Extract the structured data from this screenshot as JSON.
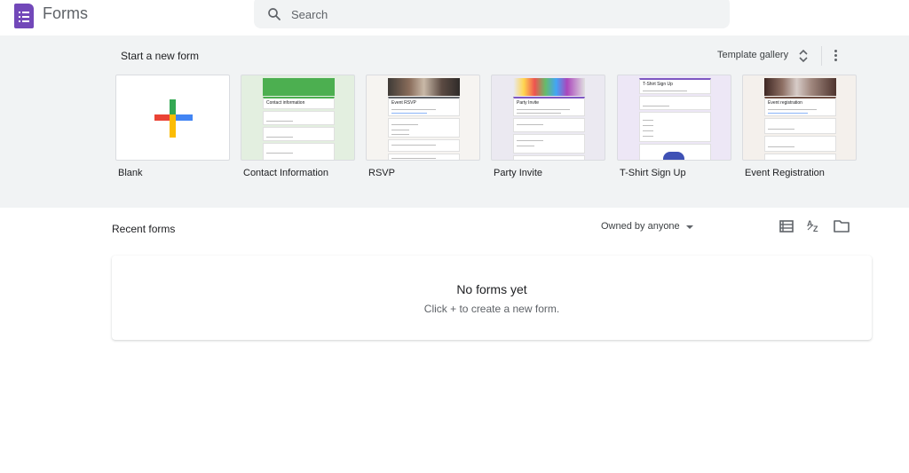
{
  "app": {
    "name": "Forms",
    "logo_icon": "google-forms-icon",
    "brand_color": "#7248b9"
  },
  "search": {
    "placeholder": "Search",
    "icon": "search-icon"
  },
  "start": {
    "title": "Start a new form",
    "gallery_label": "Template gallery",
    "gallery_icon": "unfold-more-icon",
    "more_icon": "more-vert-icon",
    "templates": [
      {
        "label": "Blank",
        "icon": "plus-icon"
      },
      {
        "label": "Contact Information",
        "mini_title": "Contact information",
        "accent": "#4caf50"
      },
      {
        "label": "RSVP",
        "mini_title": "Event RSVP",
        "accent": "#5f6368"
      },
      {
        "label": "Party Invite",
        "mini_title": "Party Invite",
        "accent": "#7e57c2"
      },
      {
        "label": "T-Shirt Sign Up",
        "mini_title": "T-Shirt Sign Up",
        "accent": "#7e57c2"
      },
      {
        "label": "Event Registration",
        "mini_title": "Event registration",
        "accent": "#6d4c41"
      }
    ]
  },
  "recent": {
    "title": "Recent forms",
    "owner_filter": "Owned by anyone",
    "view_icons": [
      "list-view-icon",
      "sort-az-icon",
      "folder-icon"
    ],
    "empty_title": "No forms yet",
    "empty_subtitle": "Click + to create a new form."
  },
  "colors": {
    "gallery_bg": "#f1f3f4",
    "plus_red": "#ea4335",
    "plus_blue": "#4285f4",
    "plus_yellow": "#fbbc04",
    "plus_green": "#34a853"
  }
}
